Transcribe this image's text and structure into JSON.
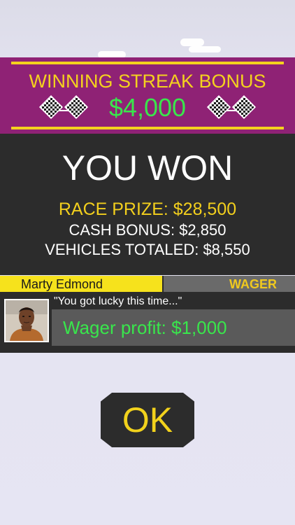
{
  "bonus": {
    "title": "WINNING STREAK BONUS",
    "amount": "$4,000",
    "icon": "checkered-flags-icon"
  },
  "result": {
    "title": "YOU WON",
    "race_prize": "RACE PRIZE: $28,500",
    "cash_bonus": "CASH BONUS: $2,850",
    "vehicles_totaled": "VEHICLES TOTALED: $8,550"
  },
  "wager": {
    "opponent_name": "Marty Edmond",
    "label": "WAGER",
    "quote": "\"You got lucky this time...\"",
    "profit": "Wager profit: $1,000"
  },
  "ok_button": {
    "label": "OK"
  },
  "colors": {
    "banner_purple": "#8f2275",
    "gold": "#f4d21e",
    "green": "#39e64c",
    "panel_dark": "#2c2c2c"
  }
}
